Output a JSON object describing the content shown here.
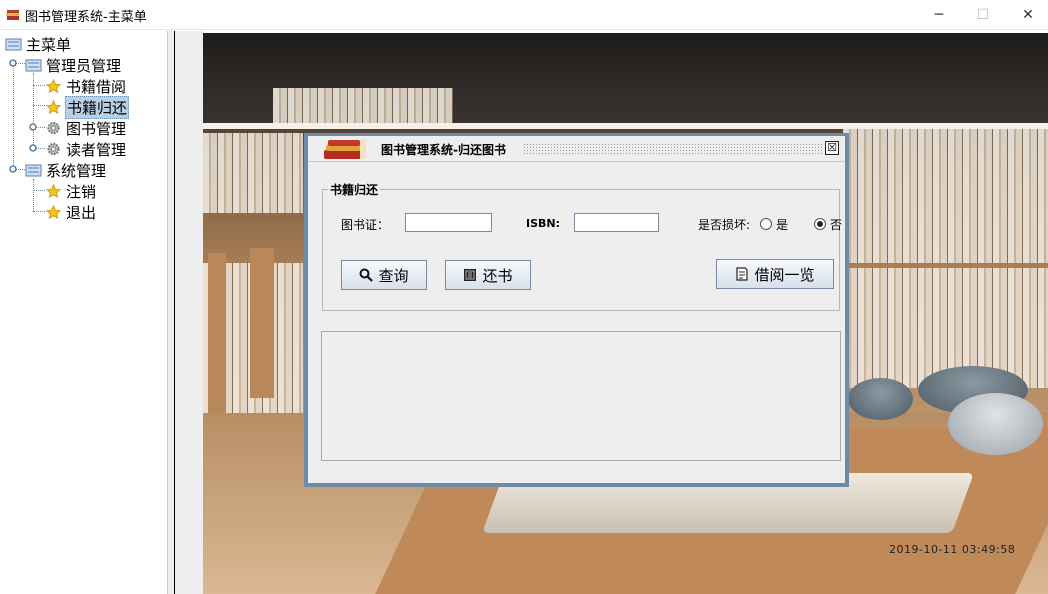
{
  "window": {
    "title": "图书管理系统-主菜单",
    "controls": {
      "minimize": "─",
      "maximize": "☐",
      "close": "✕"
    }
  },
  "tree": {
    "root": "主菜单",
    "admin": "管理员管理",
    "borrow": "书籍借阅",
    "return": "书籍归还",
    "book_manage": "图书管理",
    "reader_manage": "读者管理",
    "system": "系统管理",
    "logout": "注销",
    "exit": "退出",
    "selected": "书籍归还"
  },
  "background": {
    "timestamp": "2019-10-11  03:49:58"
  },
  "dialog": {
    "title": "图书管理系统-归还图书",
    "close_glyph": "☒",
    "group_title": "书籍归还",
    "card_label": "图书证：",
    "card_value": "",
    "isbn_label": "ISBN:",
    "isbn_value": "",
    "damaged_label": "是否损坏:",
    "option_yes": "是",
    "option_no": "否",
    "damaged_selected": "否",
    "query_button": "查询",
    "return_button": "还书",
    "borrow_list_button": "借阅一览"
  },
  "colors": {
    "frame_border": "#6d8aa8",
    "selection": "#b8cfe5",
    "panel_bg": "#eeeeee"
  }
}
